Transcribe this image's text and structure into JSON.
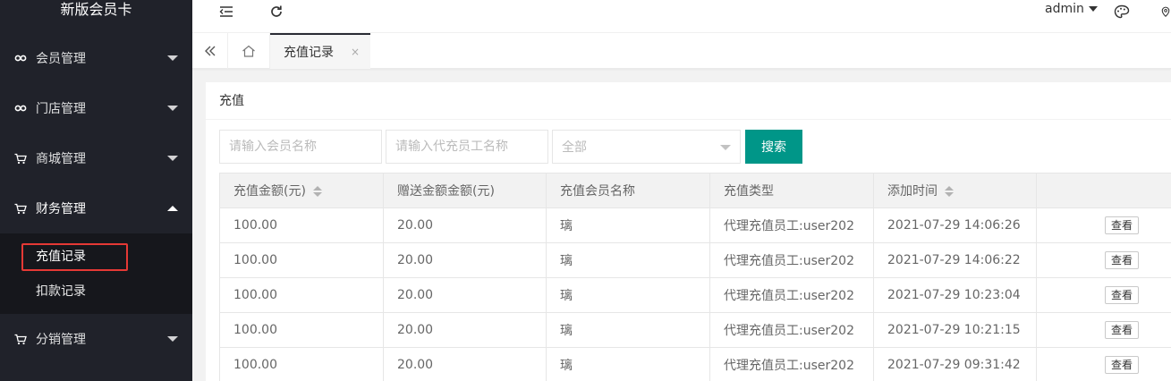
{
  "sidebar": {
    "logo": "新版会员卡",
    "items": [
      {
        "label": "会员管理",
        "icon": "link-icon"
      },
      {
        "label": "门店管理",
        "icon": "link-icon"
      },
      {
        "label": "商城管理",
        "icon": "cart-icon"
      },
      {
        "label": "财务管理",
        "icon": "cart-icon",
        "expanded": true
      },
      {
        "label": "分销管理",
        "icon": "cart-icon"
      }
    ],
    "finance_sub": [
      {
        "label": "充值记录",
        "active": true
      },
      {
        "label": "扣款记录"
      }
    ]
  },
  "header": {
    "user": "admin",
    "icons": [
      "menu-fold-icon",
      "refresh-icon",
      "palette-icon",
      "location-icon"
    ]
  },
  "tabs": {
    "active": {
      "label": "充值记录",
      "close": "×"
    },
    "controls": [
      "double-left-icon",
      "home-icon"
    ]
  },
  "card": {
    "title": "充值",
    "filters": {
      "member_placeholder": "请输入会员名称",
      "staff_placeholder": "请输入代充员工名称",
      "type_selected": "全部",
      "search_label": "搜索"
    }
  },
  "table": {
    "columns": [
      "充值金额(元)",
      "赠送金额金额(元)",
      "充值会员名称",
      "充值类型",
      "添加时间",
      ""
    ],
    "rows": [
      {
        "amount": "100.00",
        "bonus": "20.00",
        "member": "璃",
        "type": "代理充值员工:user202",
        "time": "2021-07-29 14:06:26",
        "action": "查看"
      },
      {
        "amount": "100.00",
        "bonus": "20.00",
        "member": "璃",
        "type": "代理充值员工:user202",
        "time": "2021-07-29 14:06:22",
        "action": "查看"
      },
      {
        "amount": "100.00",
        "bonus": "20.00",
        "member": "璃",
        "type": "代理充值员工:user202",
        "time": "2021-07-29 10:23:04",
        "action": "查看"
      },
      {
        "amount": "100.00",
        "bonus": "20.00",
        "member": "璃",
        "type": "代理充值员工:user202",
        "time": "2021-07-29 10:21:15",
        "action": "查看"
      },
      {
        "amount": "100.00",
        "bonus": "20.00",
        "member": "璃",
        "type": "代理充值员工:user202",
        "time": "2021-07-29 09:31:42",
        "action": "查看"
      }
    ]
  },
  "colors": {
    "sidebar_bg": "#20222a",
    "submenu_bg": "#16171c",
    "primary": "#009688",
    "highlight": "#e53935"
  }
}
